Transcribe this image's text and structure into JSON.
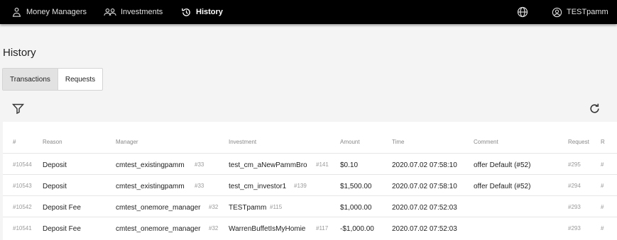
{
  "nav": {
    "money_managers": "Money Managers",
    "investments": "Investments",
    "history": "History",
    "user": "TESTpamm"
  },
  "page": {
    "title": "History"
  },
  "tabs": [
    {
      "label": "Transactions",
      "active": true
    },
    {
      "label": "Requests",
      "active": false
    }
  ],
  "table": {
    "headers": [
      "#",
      "Reason",
      "Manager",
      "Investment",
      "Amount",
      "Time",
      "Comment",
      "Request",
      "R"
    ],
    "rows": [
      {
        "id": "#10544",
        "reason": "Deposit",
        "manager": "cmtest_existingpamm",
        "manager_id": "#33",
        "investment": "test_cm_aNewPammBro",
        "investment_id": "#141",
        "amount": "$0.10",
        "time": "2020.07.02 07:58:10",
        "comment": "offer Default (#52)",
        "request": "#295",
        "r": "#"
      },
      {
        "id": "#10543",
        "reason": "Deposit",
        "manager": "cmtest_existingpamm",
        "manager_id": "#33",
        "investment": "test_cm_investor1",
        "investment_id": "#139",
        "amount": "$1,500.00",
        "time": "2020.07.02 07:58:10",
        "comment": "offer Default (#52)",
        "request": "#294",
        "r": "#"
      },
      {
        "id": "#10542",
        "reason": "Deposit Fee",
        "manager": "cmtest_onemore_manager",
        "manager_id": "#32",
        "investment": "TESTpamm",
        "investment_id": "#115",
        "amount": "$1,000.00",
        "time": "2020.07.02 07:52:03",
        "comment": "",
        "request": "#293",
        "r": "#"
      },
      {
        "id": "#10541",
        "reason": "Deposit Fee",
        "manager": "cmtest_onemore_manager",
        "manager_id": "#32",
        "investment": "WarrenBuffetIsMyHomie",
        "investment_id": "#117",
        "amount": "-$1,000.00",
        "time": "2020.07.02 07:52:03",
        "comment": "",
        "request": "#293",
        "r": "#"
      }
    ]
  },
  "icons": {
    "money_managers": "people-stack-icon",
    "investments": "group-icon",
    "history": "history-icon",
    "language": "globe-icon",
    "user": "user-circle-icon",
    "filter": "filter-icon",
    "refresh": "refresh-icon"
  }
}
